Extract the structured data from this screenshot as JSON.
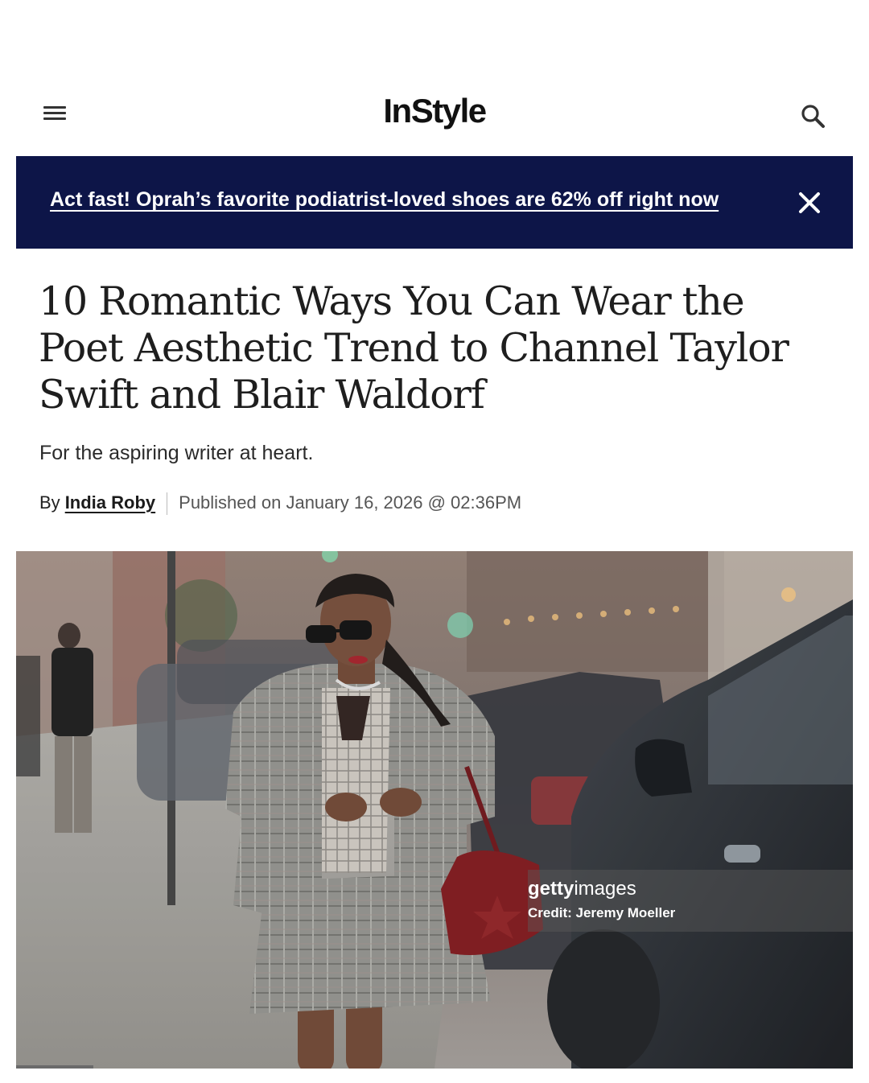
{
  "header": {
    "logo": "InStyle",
    "menu_icon": "hamburger-menu-icon",
    "search_icon": "search-icon"
  },
  "promo": {
    "text": "Act fast! Oprah’s favorite podiatrist-loved shoes are 62% off right now",
    "close_icon": "close-icon",
    "background": "#0d1548"
  },
  "article": {
    "headline": "10 Romantic Ways You Can Wear the Poet Aesthetic Trend to Channel Taylor Swift and Blair Waldorf",
    "dek": "For the aspiring writer at heart.",
    "by_label": "By",
    "author": "India Roby",
    "published": "Published on January 16, 2026 @ 02:36PM"
  },
  "image": {
    "watermark_brand_bold": "getty",
    "watermark_brand_light": "images",
    "credit": "Credit: Jeremy Moeller"
  }
}
